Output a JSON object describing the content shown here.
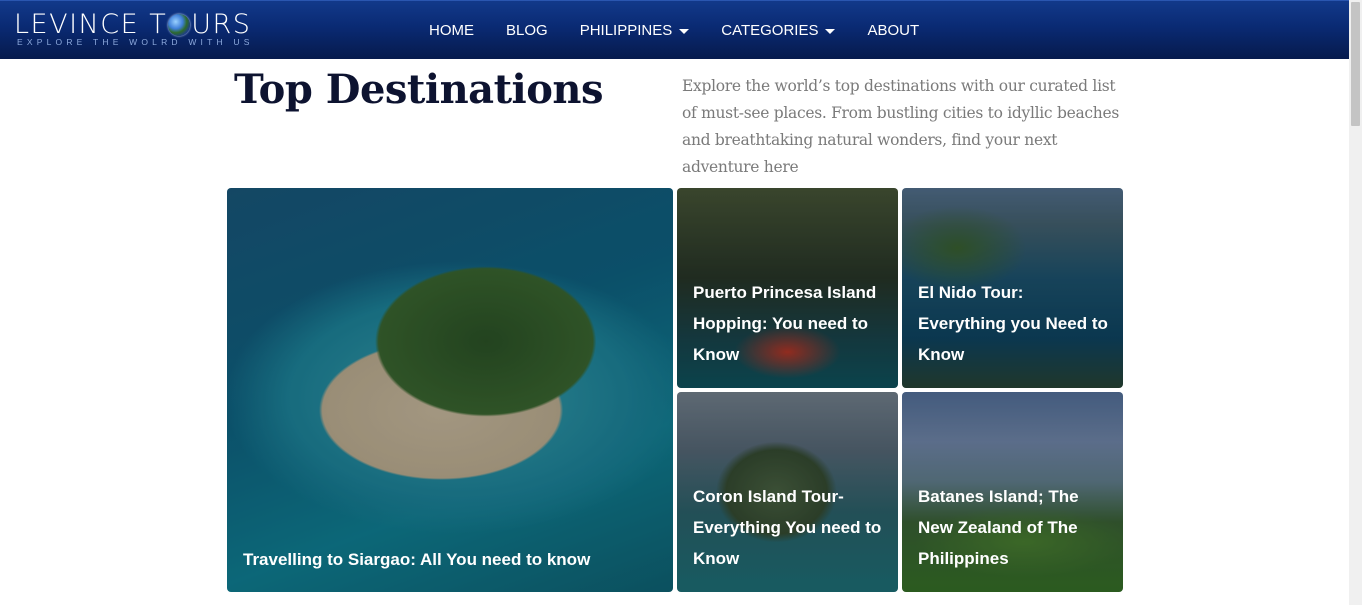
{
  "header": {
    "logo_main_left": "LEVINCE T",
    "logo_main_right": "URS",
    "logo_tagline": "EXPLORE THE WOLRD WITH US",
    "nav": [
      {
        "label": "HOME",
        "has_dropdown": false
      },
      {
        "label": "BLOG",
        "has_dropdown": false
      },
      {
        "label": "PHILIPPINES",
        "has_dropdown": true
      },
      {
        "label": "CATEGORIES",
        "has_dropdown": true
      },
      {
        "label": "ABOUT",
        "has_dropdown": false
      }
    ]
  },
  "intro": {
    "title": "Top Destinations",
    "description": "Explore the world’s top destinations with our curated list of must-see places. From  bustling cities to idyllic beaches and breathtaking natural wonders, find your next adventure here"
  },
  "destinations": [
    {
      "title": "Travelling to Siargao: All You need to know"
    },
    {
      "title": "Puerto Princesa Island Hopping: You need to Know"
    },
    {
      "title": "El Nido Tour: Everything you Need to Know"
    },
    {
      "title": "Coron Island Tour- Everything You need to Know"
    },
    {
      "title": "Batanes Island; The New Zealand of The Philippines"
    }
  ],
  "colors": {
    "header_bg": "#0a2a73",
    "title_text": "#0d1330",
    "body_text": "#7a7a7a"
  }
}
